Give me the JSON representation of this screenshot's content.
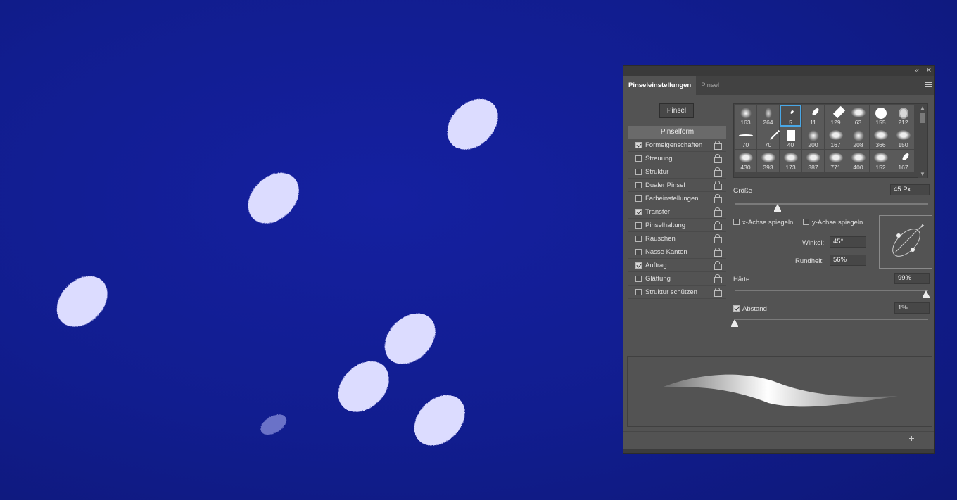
{
  "canvas": {
    "dab_color": "#dcdcff",
    "background_color": "#111d8f"
  },
  "panel": {
    "collapse_icon": "double-chevron-left-icon",
    "close_icon": "close-icon",
    "tabs": [
      {
        "label": "Pinseleinstellungen",
        "active": true
      },
      {
        "label": "Pinsel",
        "active": false
      }
    ],
    "menu_icon": "hamburger-menu-icon",
    "pinsel_button": "Pinsel",
    "list_header": "Pinselform",
    "options": [
      {
        "label": "Formeigenschaften",
        "checked": true
      },
      {
        "label": "Streuung",
        "checked": false
      },
      {
        "label": "Struktur",
        "checked": false
      },
      {
        "label": "Dualer Pinsel",
        "checked": false
      },
      {
        "label": "Farbeinstellungen",
        "checked": false
      },
      {
        "label": "Transfer",
        "checked": true
      },
      {
        "label": "Pinselhaltung",
        "checked": false
      },
      {
        "label": "Rauschen",
        "checked": false
      },
      {
        "label": "Nasse Kanten",
        "checked": false
      },
      {
        "label": "Auftrag",
        "checked": true
      },
      {
        "label": "Glättung",
        "checked": false
      },
      {
        "label": "Struktur schützen",
        "checked": false
      }
    ],
    "brushes": [
      {
        "size": "163"
      },
      {
        "size": "264"
      },
      {
        "size": "5",
        "selected": true
      },
      {
        "size": "11"
      },
      {
        "size": "129"
      },
      {
        "size": "63"
      },
      {
        "size": "155"
      },
      {
        "size": "212"
      },
      {
        "size": "70"
      },
      {
        "size": "70"
      },
      {
        "size": "40"
      },
      {
        "size": "200"
      },
      {
        "size": "167"
      },
      {
        "size": "208"
      },
      {
        "size": "366"
      },
      {
        "size": "150"
      },
      {
        "size": "430"
      },
      {
        "size": "393"
      },
      {
        "size": "173"
      },
      {
        "size": "387"
      },
      {
        "size": "771"
      },
      {
        "size": "400"
      },
      {
        "size": "152"
      },
      {
        "size": "167"
      }
    ],
    "size_label": "Größe",
    "size_value": "45 Px",
    "size_slider_fraction": 0.22,
    "flip_x_label": "x-Achse spiegeln",
    "flip_y_label": "y-Achse spiegeln",
    "flip_x_checked": false,
    "flip_y_checked": false,
    "angle_label": "Winkel:",
    "angle_value": "45°",
    "roundness_label": "Rundheit:",
    "roundness_value": "56%",
    "hardness_label": "Härte",
    "hardness_value": "99%",
    "hardness_slider_fraction": 0.99,
    "spacing_label": "Abstand",
    "spacing_checked": true,
    "spacing_value": "1%",
    "spacing_slider_fraction": 0.0,
    "new_brush_icon": "new-brush-icon"
  }
}
